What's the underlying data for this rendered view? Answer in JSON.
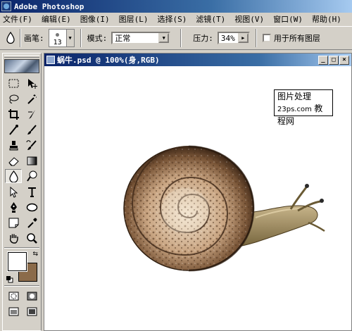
{
  "app": {
    "title": "Adobe Photoshop"
  },
  "menu": [
    "文件(F)",
    "编辑(E)",
    "图像(I)",
    "图层(L)",
    "选择(S)",
    "滤镜(T)",
    "视图(V)",
    "窗口(W)",
    "帮助(H)"
  ],
  "options": {
    "brush_label": "画笔:",
    "brush_size": "13",
    "mode_label": "模式:",
    "mode_value": "正常",
    "pressure_label": "压力:",
    "pressure_value": "34%",
    "all_layers_label": "用于所有图层"
  },
  "document": {
    "title": "蜗牛.psd @ 100%(身,RGB)"
  },
  "watermark": {
    "line1": "图片处理",
    "line2": "23ps.com",
    "line3": "教程网"
  },
  "colors": {
    "foreground": "#ffffff",
    "background": "#8b6b4a",
    "active_tool": "blur-tool"
  }
}
